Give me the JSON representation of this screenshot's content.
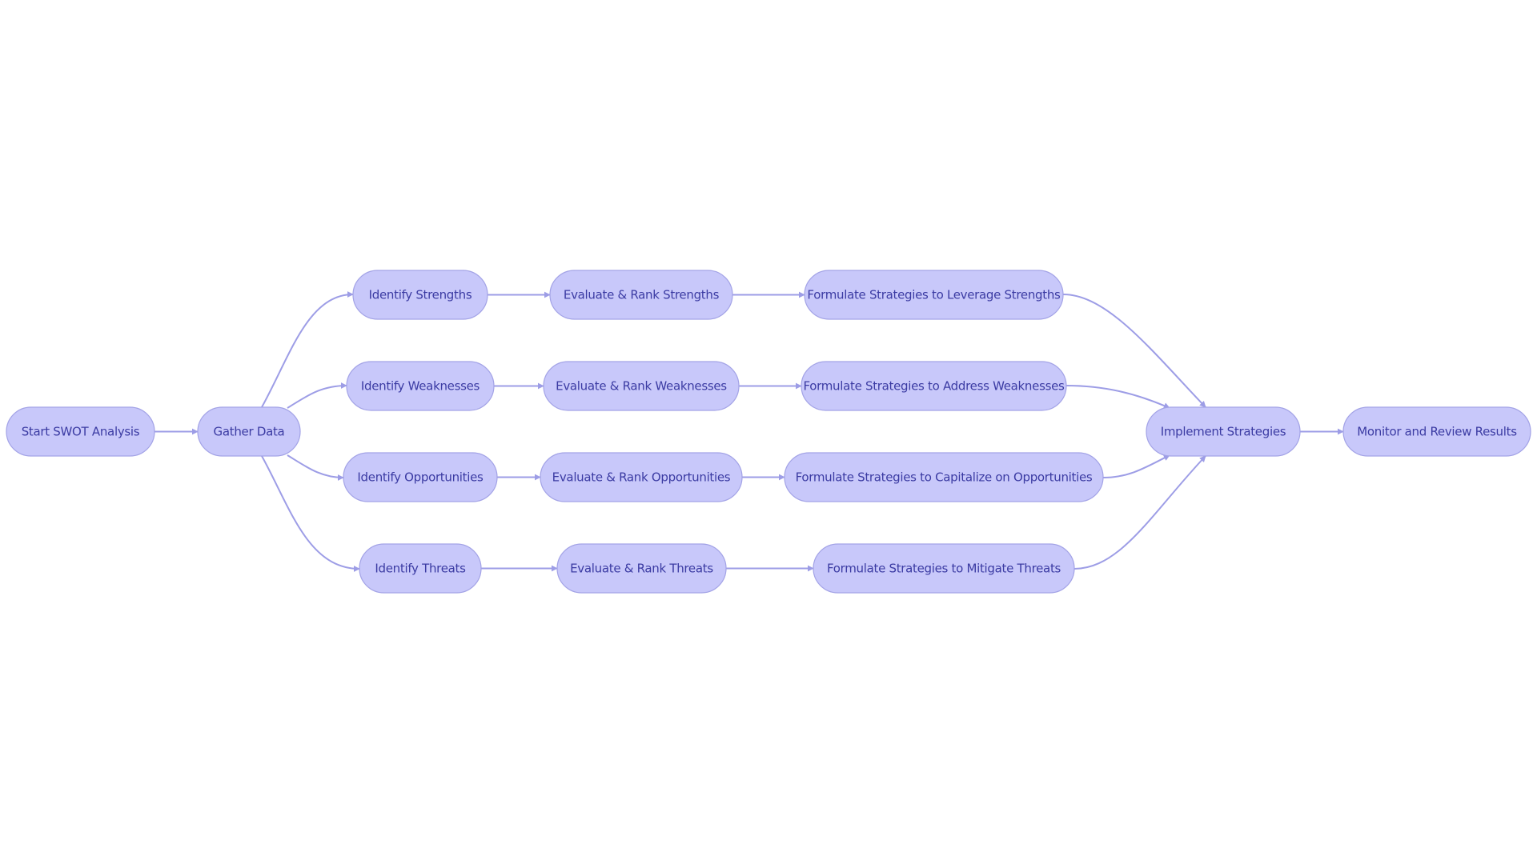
{
  "diagram": {
    "type": "flowchart",
    "direction": "left-to-right",
    "colors": {
      "node_fill": "#c8c8fa",
      "node_stroke": "#a3a3e6",
      "edge": "#9d9de6",
      "text": "#3b3ba3"
    },
    "nodes": [
      {
        "id": "start",
        "label": "Start SWOT Analysis"
      },
      {
        "id": "gather",
        "label": "Gather Data"
      },
      {
        "id": "id_s",
        "label": "Identify Strengths"
      },
      {
        "id": "id_w",
        "label": "Identify Weaknesses"
      },
      {
        "id": "id_o",
        "label": "Identify Opportunities"
      },
      {
        "id": "id_t",
        "label": "Identify Threats"
      },
      {
        "id": "ev_s",
        "label": "Evaluate & Rank Strengths"
      },
      {
        "id": "ev_w",
        "label": "Evaluate & Rank Weaknesses"
      },
      {
        "id": "ev_o",
        "label": "Evaluate & Rank Opportunities"
      },
      {
        "id": "ev_t",
        "label": "Evaluate & Rank Threats"
      },
      {
        "id": "fs_s",
        "label": "Formulate Strategies to Leverage Strengths"
      },
      {
        "id": "fs_w",
        "label": "Formulate Strategies to Address Weaknesses"
      },
      {
        "id": "fs_o",
        "label": "Formulate Strategies to Capitalize on Opportunities"
      },
      {
        "id": "fs_t",
        "label": "Formulate Strategies to Mitigate Threats"
      },
      {
        "id": "impl",
        "label": "Implement Strategies"
      },
      {
        "id": "monitor",
        "label": "Monitor and Review Results"
      }
    ],
    "edges": [
      {
        "from": "start",
        "to": "gather"
      },
      {
        "from": "gather",
        "to": "id_s"
      },
      {
        "from": "gather",
        "to": "id_w"
      },
      {
        "from": "gather",
        "to": "id_o"
      },
      {
        "from": "gather",
        "to": "id_t"
      },
      {
        "from": "id_s",
        "to": "ev_s"
      },
      {
        "from": "id_w",
        "to": "ev_w"
      },
      {
        "from": "id_o",
        "to": "ev_o"
      },
      {
        "from": "id_t",
        "to": "ev_t"
      },
      {
        "from": "ev_s",
        "to": "fs_s"
      },
      {
        "from": "ev_w",
        "to": "fs_w"
      },
      {
        "from": "ev_o",
        "to": "fs_o"
      },
      {
        "from": "ev_t",
        "to": "fs_t"
      },
      {
        "from": "fs_s",
        "to": "impl"
      },
      {
        "from": "fs_w",
        "to": "impl"
      },
      {
        "from": "fs_o",
        "to": "impl"
      },
      {
        "from": "fs_t",
        "to": "impl"
      },
      {
        "from": "impl",
        "to": "monitor"
      }
    ]
  }
}
